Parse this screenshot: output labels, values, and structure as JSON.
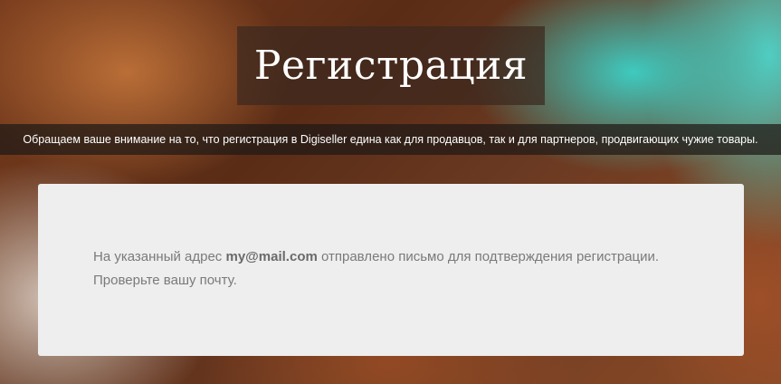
{
  "header": {
    "title": "Регистрация"
  },
  "notice": {
    "text": "Обращаем ваше внимание на то, что регистрация в Digiseller едина как для продавцов, так и для партнеров, продвигающих чужие товары."
  },
  "confirmation": {
    "text_before": "На указанный адрес ",
    "email": "my@mail.com",
    "text_after": " отправлено письмо для подтверждения регистрации.",
    "line2": "Проверьте вашу почту."
  }
}
